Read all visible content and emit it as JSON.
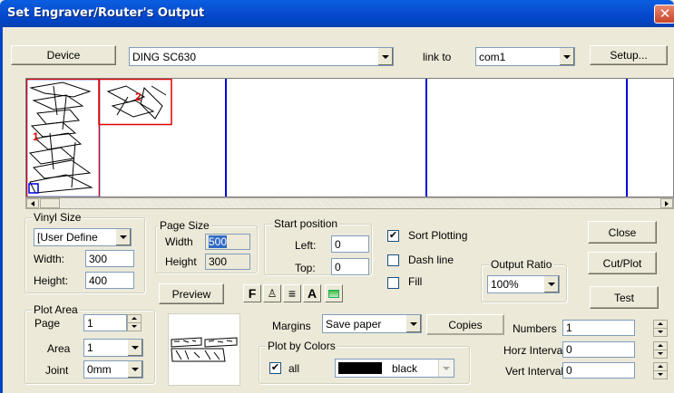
{
  "window": {
    "title": "Set Engraver/Router's Output"
  },
  "top": {
    "device_button": "Device",
    "device_value": "DING SC630",
    "link_to_label": "link to",
    "port_value": "com1",
    "setup_button": "Setup..."
  },
  "preview_labels": {
    "n1": "1",
    "n2": "2"
  },
  "vinyl": {
    "group": "Vinyl Size",
    "type_value": "[User Define",
    "width_label": "Width:",
    "width_value": "300",
    "height_label": "Height:",
    "height_value": "400"
  },
  "page_size": {
    "group": "Page Size",
    "width_label": "Width",
    "width_value": "500",
    "height_label": "Height",
    "height_value": "300"
  },
  "start": {
    "group": "Start position",
    "left_label": "Left:",
    "left_value": "0",
    "top_label": "Top:",
    "top_value": "0"
  },
  "options": {
    "sort_plotting": "Sort Plotting",
    "sort_checked": "✔",
    "dash_line": "Dash line",
    "fill": "Fill"
  },
  "output_ratio": {
    "group": "Output Ratio",
    "value": "100%"
  },
  "buttons": {
    "close": "Close",
    "cut_plot": "Cut/Plot",
    "test": "Test",
    "preview": "Preview",
    "copies": "Copies"
  },
  "toolbar_icons": {
    "f": "F",
    "a": "A"
  },
  "plot_area": {
    "group": "Plot Area",
    "page_label": "Page",
    "page_value": "1",
    "area_label": "Area",
    "area_value": "1",
    "joint_label": "Joint",
    "joint_value": "0mm"
  },
  "margins": {
    "label": "Margins",
    "value": "Save paper"
  },
  "plot_by_colors": {
    "group": "Plot by Colors",
    "all_label": "all",
    "all_checked": "✔",
    "color_name": "black",
    "swatch": "#000000"
  },
  "numbers": {
    "numbers_label": "Numbers",
    "numbers_value": "1",
    "horz_label": "Horz Interval",
    "horz_value": "0",
    "vert_label": "Vert Interval",
    "vert_value": "0"
  }
}
